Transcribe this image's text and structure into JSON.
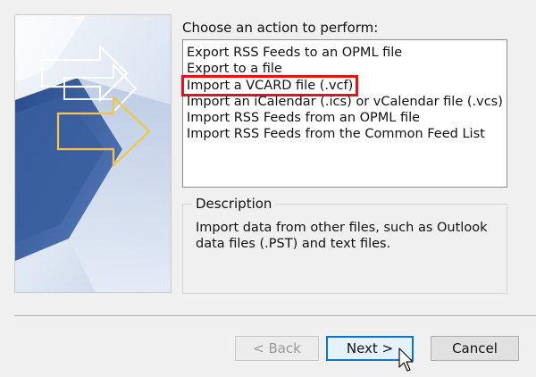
{
  "dialog": {
    "prompt": "Choose an action to perform:",
    "actions": [
      "Export RSS Feeds to an OPML file",
      "Export to a file",
      "Import a VCARD file (.vcf)",
      "Import an iCalendar (.ics) or vCalendar file (.vcs)",
      "Import RSS Feeds from an OPML file",
      "Import RSS Feeds from the Common Feed List"
    ],
    "selected_action": "Import a VCARD file (.vcf)",
    "description": {
      "legend": "Description",
      "text": "Import data from other files, such as Outlook data files (.PST) and text files."
    },
    "buttons": {
      "back": "< Back",
      "next": "Next >",
      "cancel": "Cancel"
    }
  },
  "colors": {
    "highlight_box": "#e0141c",
    "default_button_border": "#0078d7",
    "banner_blue": "#2f5597"
  },
  "icons": [
    "arrow-graphic",
    "mouse-pointer-icon"
  ]
}
